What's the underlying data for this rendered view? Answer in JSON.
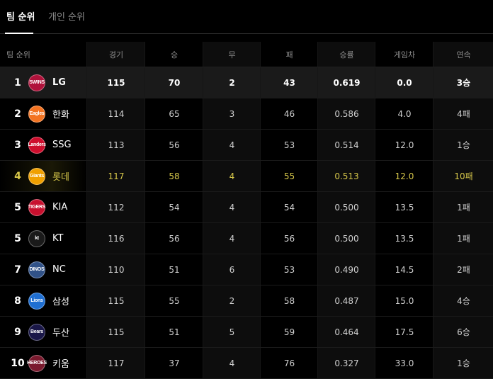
{
  "tabs": [
    {
      "label": "팀 순위",
      "active": true
    },
    {
      "label": "개인 순위",
      "active": false
    }
  ],
  "columns": {
    "team": "팀 순위",
    "games": "경기",
    "wins": "승",
    "draws": "무",
    "losses": "패",
    "pct": "승률",
    "gb": "게임차",
    "streak": "연속"
  },
  "rows": [
    {
      "rank": "1",
      "team": "LG",
      "logo": "SWINS",
      "games": "115",
      "wins": "70",
      "draws": "2",
      "losses": "43",
      "pct": "0.619",
      "gb": "0.0",
      "streak": "3승"
    },
    {
      "rank": "2",
      "team": "한화",
      "logo": "Eagles",
      "games": "114",
      "wins": "65",
      "draws": "3",
      "losses": "46",
      "pct": "0.586",
      "gb": "4.0",
      "streak": "4패"
    },
    {
      "rank": "3",
      "team": "SSG",
      "logo": "Landers",
      "games": "113",
      "wins": "56",
      "draws": "4",
      "losses": "53",
      "pct": "0.514",
      "gb": "12.0",
      "streak": "1승"
    },
    {
      "rank": "4",
      "team": "롯데",
      "logo": "Giants",
      "games": "117",
      "wins": "58",
      "draws": "4",
      "losses": "55",
      "pct": "0.513",
      "gb": "12.0",
      "streak": "10패"
    },
    {
      "rank": "5",
      "team": "KIA",
      "logo": "TIGERS",
      "games": "112",
      "wins": "54",
      "draws": "4",
      "losses": "54",
      "pct": "0.500",
      "gb": "13.5",
      "streak": "1패"
    },
    {
      "rank": "5",
      "team": "KT",
      "logo": "kt",
      "games": "116",
      "wins": "56",
      "draws": "4",
      "losses": "56",
      "pct": "0.500",
      "gb": "13.5",
      "streak": "1패"
    },
    {
      "rank": "7",
      "team": "NC",
      "logo": "DINOS",
      "games": "110",
      "wins": "51",
      "draws": "6",
      "losses": "53",
      "pct": "0.490",
      "gb": "14.5",
      "streak": "2패"
    },
    {
      "rank": "8",
      "team": "삼성",
      "logo": "Lions",
      "games": "115",
      "wins": "55",
      "draws": "2",
      "losses": "58",
      "pct": "0.487",
      "gb": "15.0",
      "streak": "4승"
    },
    {
      "rank": "9",
      "team": "두산",
      "logo": "Bears",
      "games": "115",
      "wins": "51",
      "draws": "5",
      "losses": "59",
      "pct": "0.464",
      "gb": "17.5",
      "streak": "6승"
    },
    {
      "rank": "10",
      "team": "키움",
      "logo": "HEROES",
      "games": "117",
      "wins": "37",
      "draws": "4",
      "losses": "76",
      "pct": "0.327",
      "gb": "33.0",
      "streak": "1승"
    }
  ],
  "colors": {
    "background": "#000000",
    "highlight_text": "#d9c94a",
    "top_row_bg": "#1a1a1a",
    "logo_lg": "#b0123b",
    "logo_hanwha": "#f37321",
    "logo_ssg": "#ce0e2d",
    "logo_lotte": "#f0a000",
    "logo_kia": "#c8102e",
    "logo_kt": "#1a1a1a",
    "logo_nc": "#315288",
    "logo_samsung": "#1f6fd2",
    "logo_doosan": "#1a1748",
    "logo_kiwoom": "#7a1a2e"
  }
}
